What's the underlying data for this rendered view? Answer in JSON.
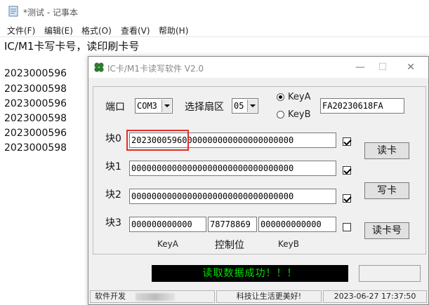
{
  "notepad": {
    "title": "*测试 - 记事本",
    "menu": [
      "文件(F)",
      "编辑(E)",
      "格式(O)",
      "查看(V)",
      "帮助(H)"
    ],
    "lines": [
      "IC/M1卡写卡号，读印刷卡号",
      "",
      "2023000596",
      "2023000598",
      "2023000596",
      "2023000598",
      "2023000596",
      "2023000598"
    ]
  },
  "reader": {
    "title": "IC卡/M1卡读写软件 V2.0",
    "port_label": "端口",
    "port_value": "COM3",
    "sector_label": "选择扇区",
    "sector_value": "05",
    "key_options": [
      {
        "label": "KeyA",
        "selected": true
      },
      {
        "label": "KeyB",
        "selected": false
      }
    ],
    "key_value": "FA20230618FA",
    "blocks": [
      {
        "label": "块0",
        "value": "20230005960000000000000000000000",
        "checked": true
      },
      {
        "label": "块1",
        "value": "00000000000000000000000000000000",
        "checked": true
      },
      {
        "label": "块2",
        "value": "00000000000000000000000000000000",
        "checked": true
      }
    ],
    "block3": {
      "label": "块3",
      "key_a": "000000000000",
      "control": "78778869",
      "key_b": "000000000000",
      "checked": false
    },
    "block3_captions": {
      "key_a": "KeyA",
      "control": "控制位",
      "key_b": "KeyB"
    },
    "buttons": {
      "read": "读卡",
      "write": "写卡",
      "read_no": "读卡号"
    },
    "status_message": "读取数据成功！！！",
    "statusbar": {
      "developer": "软件开发",
      "slogan": "科技让生活更美好!",
      "datetime": "2023-06-27  17:37:50"
    },
    "colors": {
      "lcd_bg": "#000000",
      "lcd_text": "#00e000",
      "highlight": "#e0312b"
    }
  }
}
